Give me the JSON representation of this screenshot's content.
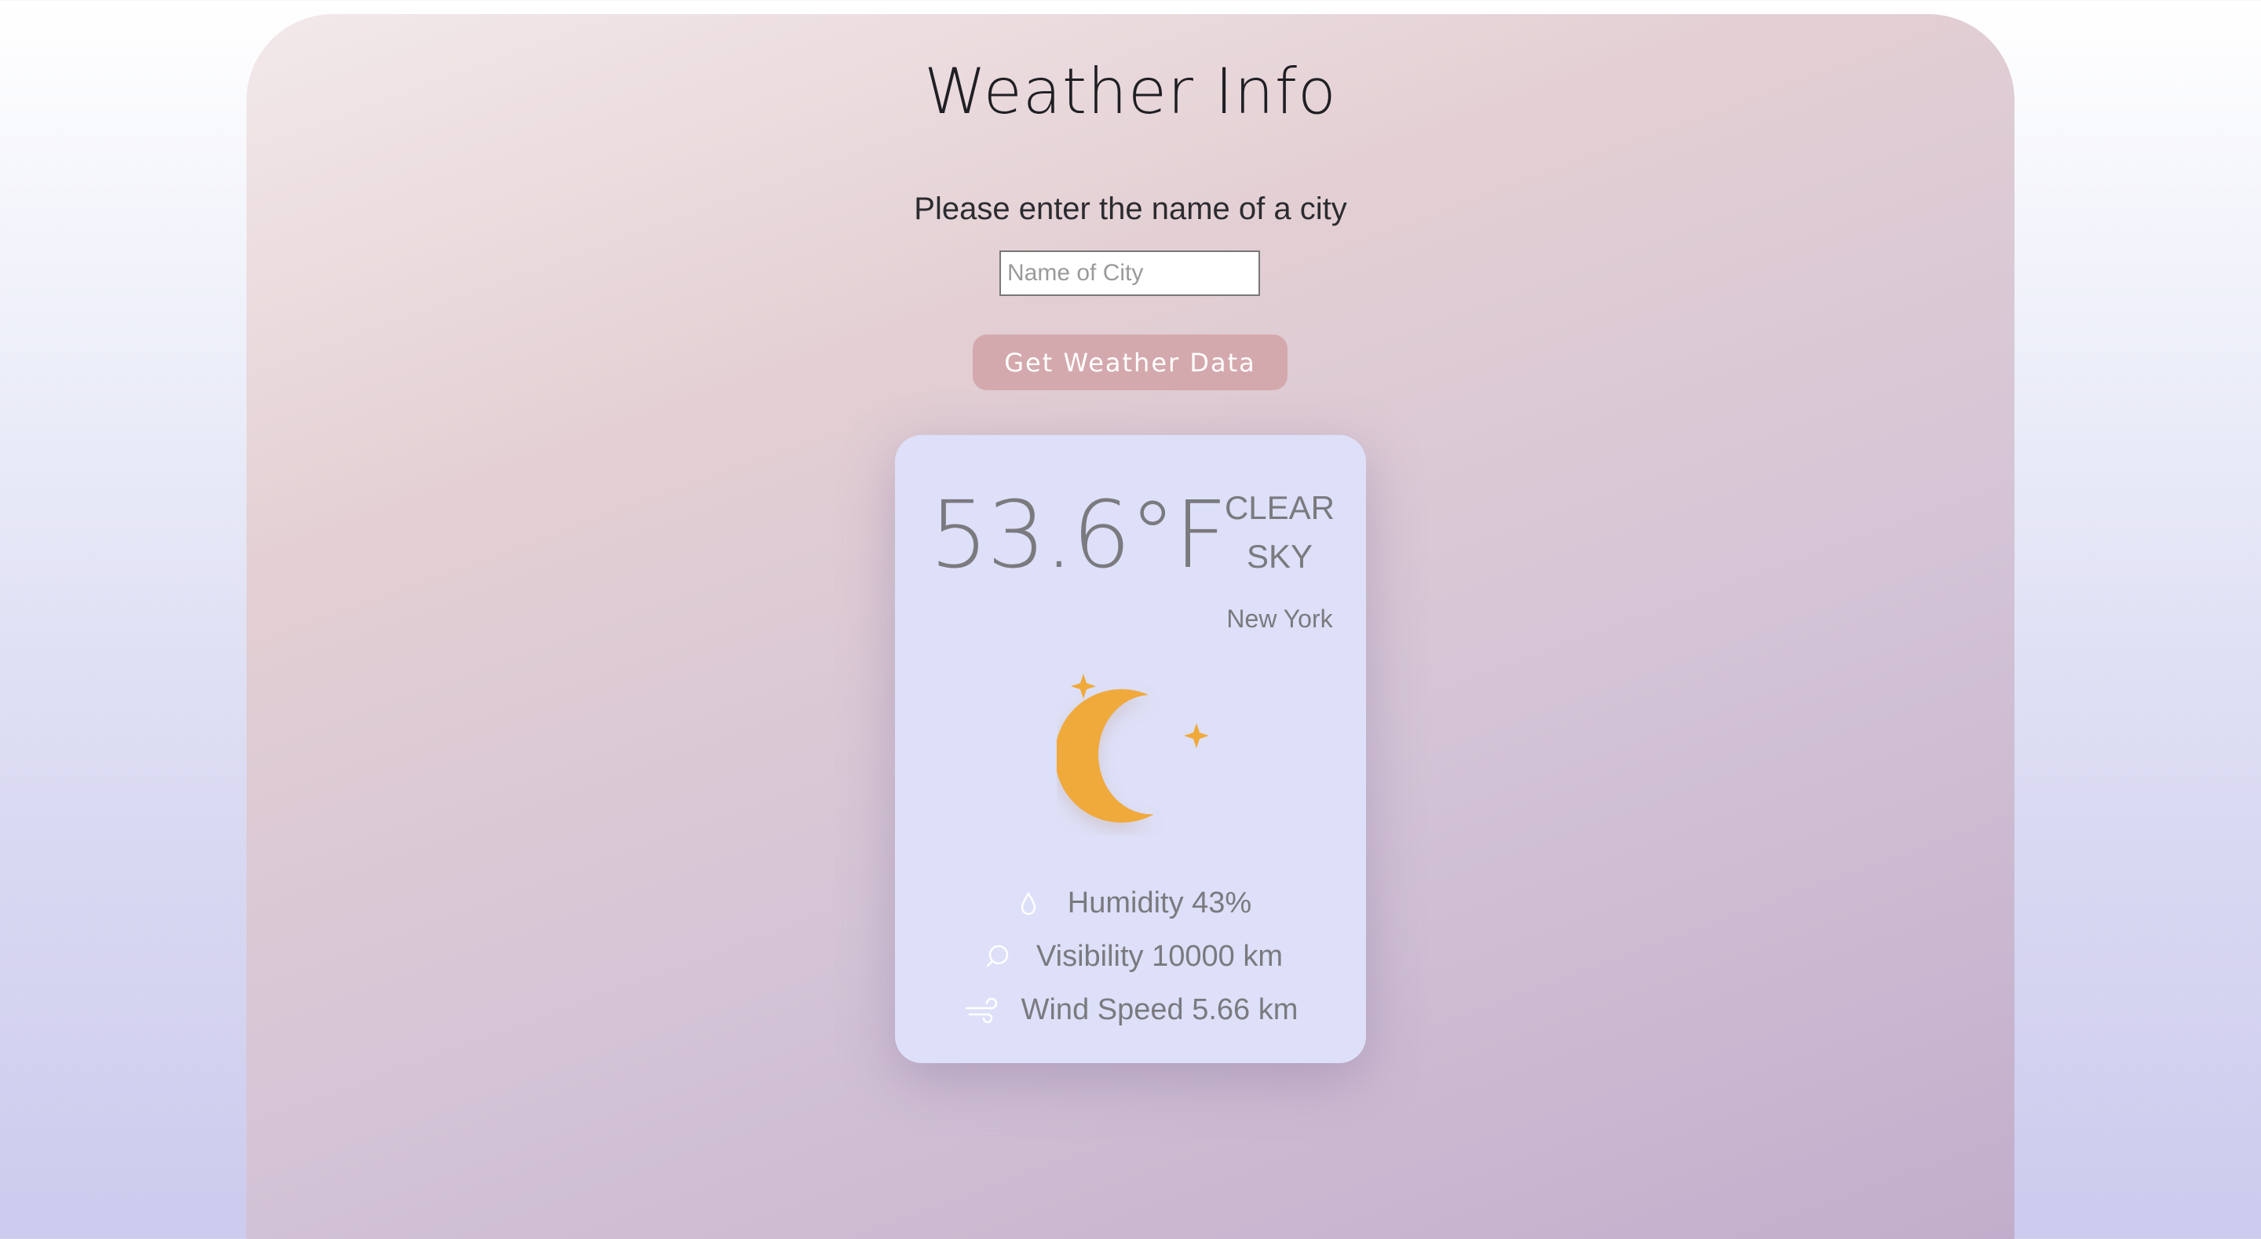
{
  "header": {
    "title": "Weather Info",
    "prompt": "Please enter the name of a city"
  },
  "search": {
    "placeholder": "Name of City",
    "value": ""
  },
  "actions": {
    "fetch_label": "Get Weather Data"
  },
  "weather": {
    "temperature": "53.6°F",
    "condition": "CLEAR SKY",
    "city": "New York",
    "icon": "moon-stars-icon",
    "humidity": "Humidity 43%",
    "visibility": "Visibility 10000 km",
    "wind": "Wind Speed 5.66 km"
  },
  "colors": {
    "accent_button": "#d4a9ad",
    "card_bg": "#dde0f8",
    "moon": "#f0a93b",
    "text_muted": "#7a7a7f"
  }
}
